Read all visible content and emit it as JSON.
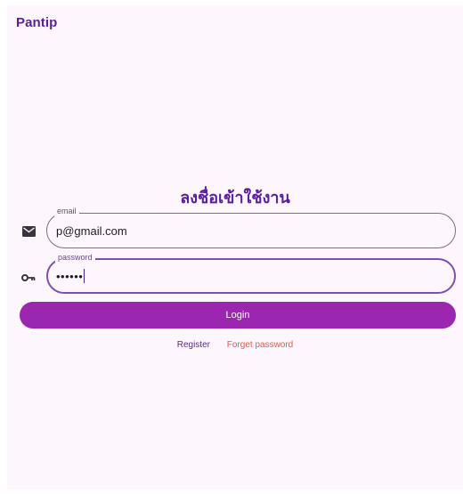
{
  "app": {
    "brand": "Pantip"
  },
  "login": {
    "title": "ลงชื่อเข้าใช้งาน",
    "email": {
      "label": "email",
      "value": "p@gmail.com",
      "icon": "envelope-icon"
    },
    "password": {
      "label": "password",
      "value": "••••••",
      "icon": "key-icon"
    },
    "login_button": "Login",
    "register_link": "Register",
    "forget_link": "Forget password"
  },
  "colors": {
    "brand": "#5a1f9e",
    "button": "#9b27b0",
    "background": "#fdf7fd",
    "forget_link": "#e05a4a"
  }
}
